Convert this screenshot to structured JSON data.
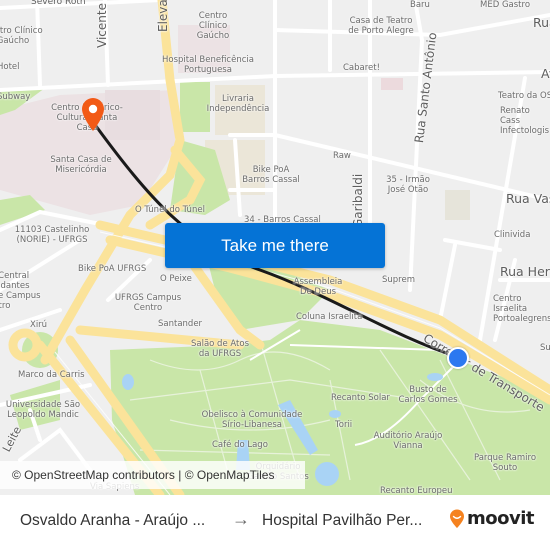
{
  "map": {
    "cta_label": "Take me there",
    "attribution": "© OpenStreetMap contributors | © OpenMapTiles",
    "colors": {
      "background": "#efefef",
      "park": "#c9e6a8",
      "road_major": "#fbe39a",
      "water": "#a9d3f5",
      "route_line": "#1a1a1a",
      "destination_pin": "#f25a16",
      "origin_dot": "#2c78f0",
      "cta_button": "#0573d6"
    },
    "streets": [
      {
        "name": "Severo Roth"
      },
      {
        "name": "Vicente"
      },
      {
        "name": "Elevada"
      },
      {
        "name": "Rua Santo Antônio"
      },
      {
        "name": "Garibaldi"
      },
      {
        "name": "Rua Vas"
      },
      {
        "name": "Rua Her"
      },
      {
        "name": "Corredor de Transporte"
      },
      {
        "name": "Av"
      },
      {
        "name": "Rua"
      },
      {
        "name": "Raw"
      },
      {
        "name": "Leite"
      }
    ],
    "pois": [
      {
        "name": "Centro Clínico Gaúcho"
      },
      {
        "name": "Centro Clínico Gaúcho"
      },
      {
        "name": "Hospital Beneficência Portuguesa"
      },
      {
        "name": "Hotel"
      },
      {
        "name": "Subway"
      },
      {
        "name": "Centro Histórico-Cultural Santa Casa"
      },
      {
        "name": "Livraria Independência"
      },
      {
        "name": "Santa Casa de Misericórdia"
      },
      {
        "name": "Baru"
      },
      {
        "name": "MED Gastro"
      },
      {
        "name": "Casa de Teatro de Porto Alegre"
      },
      {
        "name": "Cabaret!"
      },
      {
        "name": "Teatro da OS"
      },
      {
        "name": "Renato Cass Infectologis"
      },
      {
        "name": "Bike PoA Barros Cassal"
      },
      {
        "name": "35 - Irmão José Otão"
      },
      {
        "name": "O Túnel do Túnel"
      },
      {
        "name": "34 - Barros Cassal"
      },
      {
        "name": "11103 Castelinho (NORIE) - UFRGS"
      },
      {
        "name": "Clinivida"
      },
      {
        "name": "Bike PoA UFRGS"
      },
      {
        "name": "O Peixe"
      },
      {
        "name": "Rio Central Estudantes Sede Campus Centro"
      },
      {
        "name": "Suprem"
      },
      {
        "name": "Assembleia De Deus"
      },
      {
        "name": "UFRGS Campus Centro"
      },
      {
        "name": "Centro Israelita Portoalegrense"
      },
      {
        "name": "Coluna Israelita"
      },
      {
        "name": "Santander"
      },
      {
        "name": "Xirú"
      },
      {
        "name": "Salão de Atos da UFRGS"
      },
      {
        "name": "Su"
      },
      {
        "name": "Marco da Carris"
      },
      {
        "name": "Recanto Solar"
      },
      {
        "name": "Busto de Carlos Gomes"
      },
      {
        "name": "Universidade São Leopoldo Mandic"
      },
      {
        "name": "Obelisco à Comunidade Sírio-Libanesa"
      },
      {
        "name": "Torii"
      },
      {
        "name": "Auditório Araújo Vianna"
      },
      {
        "name": "Café do Lago"
      },
      {
        "name": "Parque Ramiro Souto"
      },
      {
        "name": "Orquidário Gastão Santos"
      },
      {
        "name": "Via Sapiens"
      },
      {
        "name": "Recanto Europeu"
      }
    ]
  },
  "footer": {
    "from": "Osvaldo Aranha - Araújo ...",
    "arrow": "→",
    "to": "Hospital Pavilhão Per...",
    "brand": "moovit"
  }
}
